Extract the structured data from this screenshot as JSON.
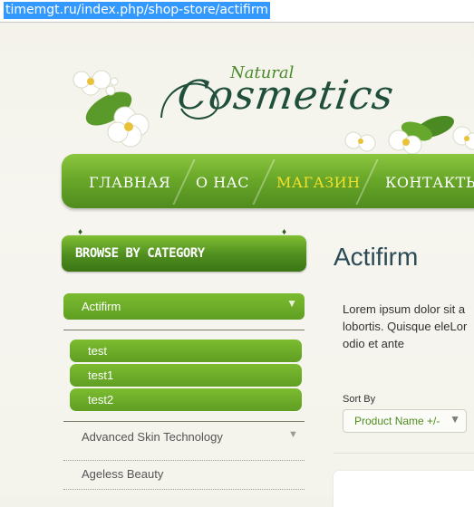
{
  "browser": {
    "url": "timemgt.ru/index.php/shop-store/actifirm"
  },
  "logo": {
    "natural": "Natural",
    "cosmetics": "Cosmetics"
  },
  "nav": {
    "items": [
      "ГЛАВНАЯ",
      "О НАС",
      "МАГАЗИН",
      "КОНТАКТЫ"
    ],
    "active_index": 2
  },
  "sidebar": {
    "heading": "BROWSE BY CATEGORY",
    "active_category": "Actifirm",
    "sub_items": [
      "test",
      "test1",
      "test2"
    ],
    "categories": [
      "Advanced Skin Technology",
      "Ageless Beauty"
    ]
  },
  "main": {
    "title": "Actifirm",
    "description": "Lorem ipsum dolor sit a\nlobortis. Quisque eleLor\nodio et ante",
    "sort_label": "Sort By",
    "sort_value": "Product Name +/-"
  },
  "colors": {
    "accent_green": "#6aa82a",
    "active_nav": "#f2e12a",
    "title": "#2b4a55"
  }
}
